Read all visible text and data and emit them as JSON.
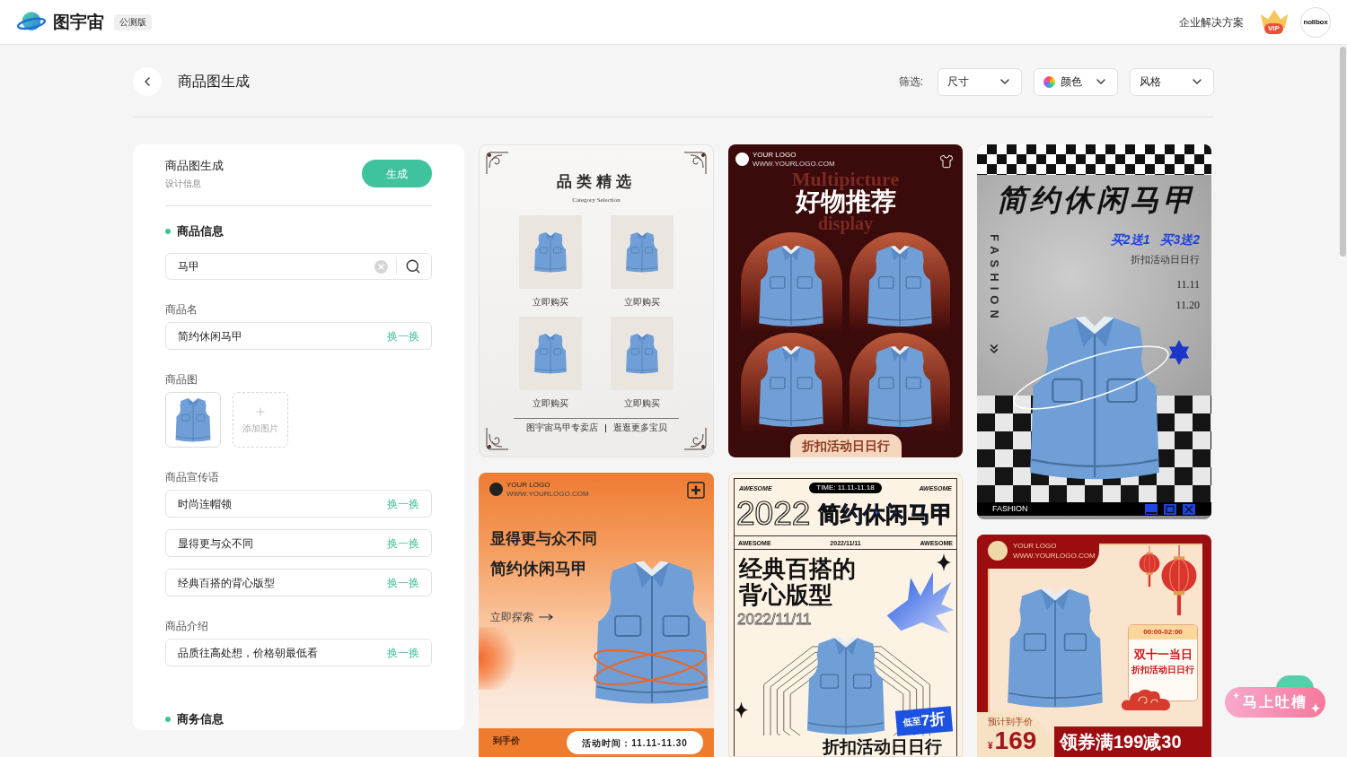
{
  "header": {
    "brand": "图宇宙",
    "version_tag": "公测版",
    "enterprise_link": "企业解决方案",
    "vip_label": "VIP",
    "avatar_text": "nolibox"
  },
  "toolbar": {
    "title": "商品图生成",
    "filter_label": "筛选:",
    "filters": [
      {
        "kind": "plain",
        "label": "尺寸"
      },
      {
        "kind": "color",
        "label": "颜色"
      },
      {
        "kind": "plain",
        "label": "风格"
      }
    ]
  },
  "form": {
    "title": "商品图生成",
    "subtitle": "设计信息",
    "submit": "生成",
    "sections": [
      {
        "heading": "商品信息",
        "search": {
          "value": "马甲"
        },
        "groups": [
          {
            "kind": "text",
            "label": "商品名",
            "items": [
              {
                "value": "简约休闲马甲",
                "action": "换一换"
              }
            ]
          },
          {
            "kind": "images",
            "label": "商品图",
            "add_label": "添加图片"
          },
          {
            "kind": "text",
            "label": "商品宣传语",
            "items": [
              {
                "value": "时尚连帽领",
                "action": "换一换"
              },
              {
                "value": "显得更与众不同",
                "action": "换一换"
              },
              {
                "value": "经典百搭的背心版型",
                "action": "换一换"
              }
            ]
          },
          {
            "kind": "text",
            "label": "商品介绍",
            "items": [
              {
                "value": "品质往高处想，价格朝最低看",
                "action": "换一换"
              }
            ]
          }
        ]
      },
      {
        "heading": "商务信息"
      }
    ]
  },
  "templates": [
    {
      "kind": "category",
      "title": "品类精选",
      "subtitle": "Category Selection",
      "products": [
        {
          "label": "立即购买"
        },
        {
          "label": "立即购买"
        },
        {
          "label": "立即购买"
        },
        {
          "label": "立即购买"
        }
      ],
      "shop": "图宇宙马甲专卖店",
      "more": "逛逛更多宝贝"
    },
    {
      "kind": "recommend",
      "logo": "YOUR LOGO",
      "url": "WWW.YOURLOGO.COM",
      "backdrop": [
        "Multipicture",
        "display"
      ],
      "title": "好物推荐",
      "tag": "折扣活动日日行"
    },
    {
      "kind": "checker",
      "title": "简约休闲马甲",
      "offers": [
        "买2送1",
        "买3送2"
      ],
      "note": "折扣活动日日行",
      "dates": [
        "11.11",
        "11.20"
      ],
      "side_text": "FASHION",
      "bar_text": "FASHION"
    },
    {
      "kind": "orange",
      "logo": "YOUR LOGO",
      "url": "WWW.YOURLOGO.COM",
      "headline": "显得更与众不同",
      "title": "简约休闲马甲",
      "cta": "立即探索",
      "price_label": "到手价",
      "period": "活动时间：11.11-11.30"
    },
    {
      "kind": "retro",
      "corner_left": "AWESOME",
      "time": "TIME: 11.11-11.18",
      "corner_right": "AWESOME",
      "year": "2022",
      "title": "简约休闲马甲",
      "strip": [
        "AWESOME",
        "2022/11/11",
        "AWESOME"
      ],
      "headline": [
        "经典百搭的",
        "背心版型"
      ],
      "date": "2022/11/11",
      "badge_prefix": "低至",
      "badge_value": "7折",
      "footer": "折扣活动日日行"
    },
    {
      "kind": "festival",
      "logo": "YOUR LOGO",
      "url": "WWW.YOURLOGO.COM",
      "time": "00:00-02:00",
      "title": "双十一当日",
      "subtitle": "折扣活动日日行",
      "price_label": "预计到手价",
      "currency": "¥",
      "price": "169",
      "coupon": "领券满199减30"
    }
  ],
  "feedback_button": "马上吐槽"
}
